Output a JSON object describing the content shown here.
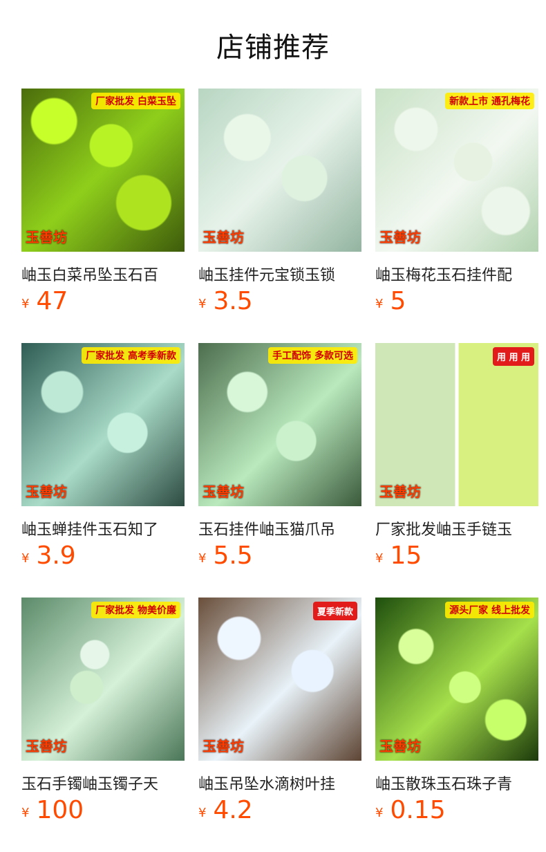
{
  "page_title": "店铺推荐",
  "currency_symbol": "¥",
  "products": [
    {
      "name": "岫玉白菜吊坠玉石百",
      "price": "47",
      "overlay_text": "厂家批发 白菜玉坠",
      "brand_text": "玉善坊"
    },
    {
      "name": "岫玉挂件元宝锁玉锁",
      "price": "3.5",
      "overlay_text": "",
      "brand_text": "玉善坊"
    },
    {
      "name": "岫玉梅花玉石挂件配",
      "price": "5",
      "overlay_text": "新款上市 通孔梅花",
      "brand_text": "玉善坊"
    },
    {
      "name": "岫玉蝉挂件玉石知了",
      "price": "3.9",
      "overlay_text": "厂家批发 高考季新款",
      "brand_text": "玉善坊"
    },
    {
      "name": "玉石挂件岫玉猫爪吊",
      "price": "5.5",
      "overlay_text": "手工配饰 多款可选",
      "brand_text": "玉善坊"
    },
    {
      "name": "厂家批发岫玉手链玉",
      "price": "15",
      "overlay_text": "用 用 用",
      "brand_text": "玉善坊"
    },
    {
      "name": "玉石手镯岫玉镯子天",
      "price": "100",
      "overlay_text": "厂家批发 物美价廉",
      "brand_text": "玉善坊"
    },
    {
      "name": "岫玉吊坠水滴树叶挂",
      "price": "4.2",
      "overlay_text": "夏季新款",
      "brand_text": "玉善坊"
    },
    {
      "name": "岫玉散珠玉石珠子青",
      "price": "0.15",
      "overlay_text": "源头厂家 线上批发",
      "brand_text": "玉善坊"
    }
  ]
}
